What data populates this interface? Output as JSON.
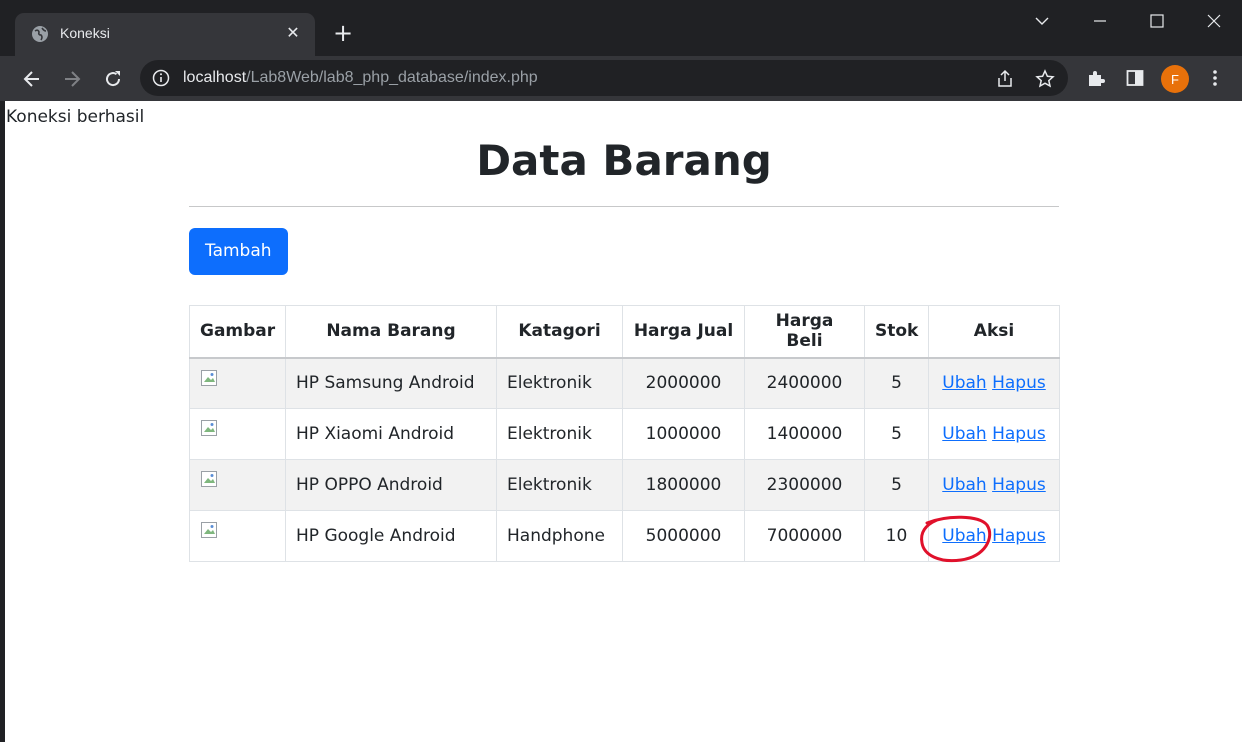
{
  "browser": {
    "tab_title": "Koneksi",
    "url_host": "localhost",
    "url_path": "/Lab8Web/lab8_php_database/index.php",
    "profile_initial": "F"
  },
  "page": {
    "status_text": "Koneksi berhasil",
    "title": "Data Barang",
    "add_button": "Tambah",
    "table": {
      "headers": [
        "Gambar",
        "Nama Barang",
        "Katagori",
        "Harga Jual",
        "Harga Beli",
        "Stok",
        "Aksi"
      ],
      "rows": [
        {
          "nama": "HP Samsung Android",
          "kategori": "Elektronik",
          "harga_jual": "2000000",
          "harga_beli": "2400000",
          "stok": "5",
          "ubah": "Ubah",
          "hapus": "Hapus"
        },
        {
          "nama": "HP Xiaomi Android",
          "kategori": "Elektronik",
          "harga_jual": "1000000",
          "harga_beli": "1400000",
          "stok": "5",
          "ubah": "Ubah",
          "hapus": "Hapus"
        },
        {
          "nama": "HP OPPO Android",
          "kategori": "Elektronik",
          "harga_jual": "1800000",
          "harga_beli": "2300000",
          "stok": "5",
          "ubah": "Ubah",
          "hapus": "Hapus"
        },
        {
          "nama": "HP Google Android",
          "kategori": "Handphone",
          "harga_jual": "5000000",
          "harga_beli": "7000000",
          "stok": "10",
          "ubah": "Ubah",
          "hapus": "Hapus"
        }
      ]
    }
  },
  "colors": {
    "primary": "#0d6efd",
    "annotation": "#e0112b",
    "chrome_dark": "#202124",
    "chrome_toolbar": "#35363a"
  }
}
